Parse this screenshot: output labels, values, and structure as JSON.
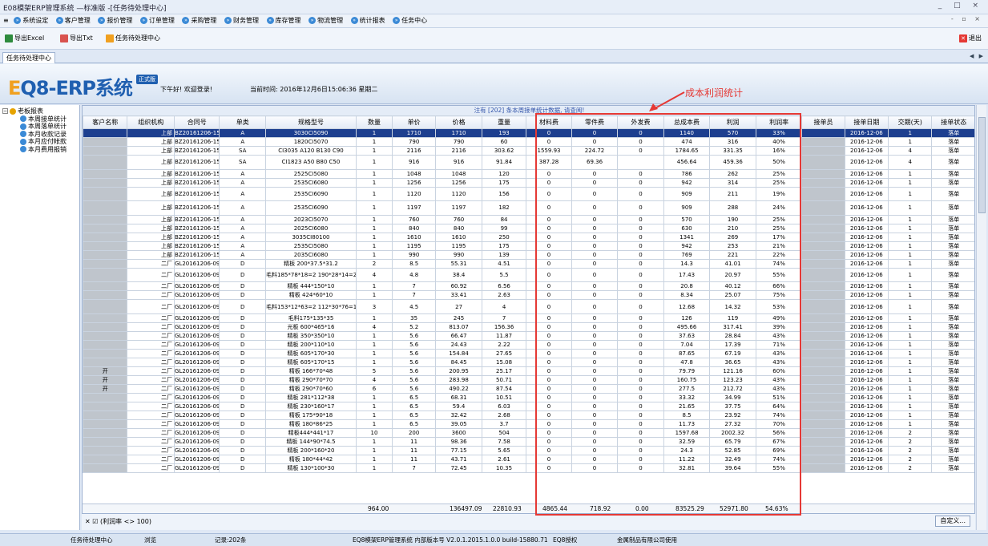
{
  "title_bar": {
    "title": "E08模架ERP管理系统 —标准版 -[任务待处理中心]",
    "window_ctrls": "_ □ ×"
  },
  "menu": {
    "items": [
      "系统设定",
      "客户管理",
      "报价管理",
      "订单管理",
      "采购管理",
      "财务管理",
      "库存管理",
      "物流管理",
      "统计报表",
      "任务中心"
    ],
    "right_ctrls": "- ▫ ×"
  },
  "toolbar": {
    "export_excel": "导出Excel",
    "export_txt": "导出Txt",
    "task_center": "任务待处理中心",
    "exit": "退出"
  },
  "tab": {
    "label": "任务待处理中心",
    "nav": "◀ ▶"
  },
  "banner": {
    "logo_e": "E",
    "logo_rest": "Q8-ERP系统",
    "badge": "正式版",
    "greeting": "下午好! 欢迎登录!",
    "time": "当前时间: 2016年12月6日15:06:36 星期二"
  },
  "tree": {
    "root": "老板报表",
    "items": [
      "本周接单统计",
      "本周落单统计",
      "本月收款记录",
      "本月应付帐款",
      "本月费用报销"
    ]
  },
  "grid_info": "注有 [202] 条本周接单统计数据, 请查阅!",
  "columns": [
    "客户名称",
    "组织机构",
    "合同号",
    "单类",
    "规格型号",
    "数量",
    "单价",
    "价格",
    "重量",
    "材料费",
    "零件费",
    "外发费",
    "总成本费",
    "利润",
    "利润率",
    "接单员",
    "接单日期",
    "交期(天)",
    "接单状态"
  ],
  "rows": [
    [
      "",
      "上部",
      "BZ20161206-1522",
      "A",
      "3030CI5090",
      "1",
      "1710",
      "1710",
      "193",
      "0",
      "0",
      "0",
      "1140",
      "570",
      "33%",
      "",
      "2016-12-06",
      "1",
      "落单"
    ],
    [
      "",
      "上部",
      "BZ20161206-1522",
      "A",
      "1820CI5070",
      "1",
      "790",
      "790",
      "60",
      "0",
      "0",
      "0",
      "474",
      "316",
      "40%",
      "",
      "2016-12-06",
      "1",
      "落单"
    ],
    [
      "",
      "上部",
      "BZ20161206-1523",
      "SA",
      "CI3035 A120 B130 C90",
      "1",
      "2116",
      "2116",
      "303.62",
      "1559.93",
      "224.72",
      "0",
      "1784.65",
      "331.35",
      "16%",
      "",
      "2016-12-06",
      "4",
      "落单"
    ],
    [
      "",
      "上部",
      "BZ20161206-1527",
      "SA",
      "CI1823 A50 B80 C50",
      "1",
      "916",
      "916",
      "91.84",
      "387.28",
      "69.36",
      "",
      "456.64",
      "459.36",
      "50%",
      "",
      "2016-12-06",
      "4",
      "落单"
    ],
    [
      "",
      "上部",
      "BZ20161206-1528",
      "A",
      "2525CI5080",
      "1",
      "1048",
      "1048",
      "120",
      "0",
      "0",
      "0",
      "786",
      "262",
      "25%",
      "",
      "2016-12-06",
      "1",
      "落单"
    ],
    [
      "",
      "上部",
      "BZ20161206-1528",
      "A",
      "2535CI6080",
      "1",
      "1256",
      "1256",
      "175",
      "0",
      "0",
      "0",
      "942",
      "314",
      "25%",
      "",
      "2016-12-06",
      "1",
      "落单"
    ],
    [
      "",
      "上部",
      "BZ20161206-1532 修1",
      "A",
      "2535CI6090",
      "1",
      "1120",
      "1120",
      "156",
      "0",
      "0",
      "0",
      "909",
      "211",
      "19%",
      "",
      "2016-12-06",
      "1",
      "落单"
    ],
    [
      "",
      "上部",
      "BZ20161206-1532 修1",
      "A",
      "2535CI6090",
      "1",
      "1197",
      "1197",
      "182",
      "0",
      "0",
      "0",
      "909",
      "288",
      "24%",
      "",
      "2016-12-06",
      "1",
      "落单"
    ],
    [
      "",
      "上部",
      "BZ20161206-1533",
      "A",
      "2023CI5070",
      "1",
      "760",
      "760",
      "84",
      "0",
      "0",
      "0",
      "570",
      "190",
      "25%",
      "",
      "2016-12-06",
      "1",
      "落单"
    ],
    [
      "",
      "上部",
      "BZ20161206-1533",
      "A",
      "2025CI6080",
      "1",
      "840",
      "840",
      "99",
      "0",
      "0",
      "0",
      "630",
      "210",
      "25%",
      "",
      "2016-12-06",
      "1",
      "落单"
    ],
    [
      "",
      "上部",
      "BZ20161206-1535",
      "A",
      "3035CI80100",
      "1",
      "1610",
      "1610",
      "250",
      "0",
      "0",
      "0",
      "1341",
      "269",
      "17%",
      "",
      "2016-12-06",
      "1",
      "落单"
    ],
    [
      "",
      "上部",
      "BZ20161206-1536",
      "A",
      "2535CI5080",
      "1",
      "1195",
      "1195",
      "175",
      "0",
      "0",
      "0",
      "942",
      "253",
      "21%",
      "",
      "2016-12-06",
      "1",
      "落单"
    ],
    [
      "",
      "上部",
      "BZ20161206-1537",
      "A",
      "2035CI6080",
      "1",
      "990",
      "990",
      "139",
      "0",
      "0",
      "0",
      "769",
      "221",
      "22%",
      "",
      "2016-12-06",
      "1",
      "落单"
    ],
    [
      "",
      "二厂",
      "GL20161206-0975",
      "D",
      "精板 200*37.5*31.2",
      "2",
      "8.5",
      "55.31",
      "4.51",
      "0",
      "0",
      "0",
      "14.3",
      "41.01",
      "74%",
      "",
      "2016-12-06",
      "1",
      "落单"
    ],
    [
      "",
      "二厂",
      "GL20161206-0975",
      "D",
      "毛料185*78*18=2 190*28*14=2",
      "4",
      "4.8",
      "38.4",
      "5.5",
      "0",
      "0",
      "0",
      "17.43",
      "20.97",
      "55%",
      "",
      "2016-12-06",
      "1",
      "落单"
    ],
    [
      "",
      "二厂",
      "GL20161206-0976",
      "D",
      "精板 444*150*10",
      "1",
      "7",
      "60.92",
      "6.56",
      "0",
      "0",
      "0",
      "20.8",
      "40.12",
      "66%",
      "",
      "2016-12-06",
      "1",
      "落单"
    ],
    [
      "",
      "二厂",
      "GL20161206-0976",
      "D",
      "精板 424*60*10",
      "1",
      "7",
      "33.41",
      "2.63",
      "0",
      "0",
      "0",
      "8.34",
      "25.07",
      "75%",
      "",
      "2016-12-06",
      "1",
      "落单"
    ],
    [
      "",
      "二厂",
      "GL20161206-0976",
      "D",
      "毛料153*12*63=2 112*30*76=1",
      "3",
      "4.5",
      "27",
      "4",
      "0",
      "0",
      "0",
      "12.68",
      "14.32",
      "53%",
      "",
      "2016-12-06",
      "1",
      "落单"
    ],
    [
      "",
      "二厂",
      "GL20161206-0978",
      "D",
      "毛料175*135*35",
      "1",
      "35",
      "245",
      "7",
      "0",
      "0",
      "0",
      "126",
      "119",
      "49%",
      "",
      "2016-12-06",
      "1",
      "落单"
    ],
    [
      "",
      "二厂",
      "GL20161206-0979",
      "D",
      "光板 600*465*16",
      "4",
      "5.2",
      "813.07",
      "156.36",
      "0",
      "0",
      "0",
      "495.66",
      "317.41",
      "39%",
      "",
      "2016-12-06",
      "1",
      "落单"
    ],
    [
      "",
      "二厂",
      "GL20161206-0979",
      "D",
      "精板 350*350*10",
      "1",
      "5.6",
      "66.47",
      "11.87",
      "0",
      "0",
      "0",
      "37.63",
      "28.84",
      "43%",
      "",
      "2016-12-06",
      "1",
      "落单"
    ],
    [
      "",
      "二厂",
      "GL20161206-0979",
      "D",
      "精板 200*110*10",
      "1",
      "5.6",
      "24.43",
      "2.22",
      "0",
      "0",
      "0",
      "7.04",
      "17.39",
      "71%",
      "",
      "2016-12-06",
      "1",
      "落单"
    ],
    [
      "",
      "二厂",
      "GL20161206-0979",
      "D",
      "精板 605*170*30",
      "1",
      "5.6",
      "154.84",
      "27.65",
      "0",
      "0",
      "0",
      "87.65",
      "67.19",
      "43%",
      "",
      "2016-12-06",
      "1",
      "落单"
    ],
    [
      "",
      "二厂",
      "GL20161206-0979",
      "D",
      "精板 605*170*15",
      "1",
      "5.6",
      "84.45",
      "15.08",
      "0",
      "0",
      "0",
      "47.8",
      "36.65",
      "43%",
      "",
      "2016-12-06",
      "1",
      "落单"
    ],
    [
      "开",
      "二厂",
      "GL20161206-0979",
      "D",
      "精板 166*70*48",
      "5",
      "5.6",
      "200.95",
      "25.17",
      "0",
      "0",
      "0",
      "79.79",
      "121.16",
      "60%",
      "",
      "2016-12-06",
      "1",
      "落单"
    ],
    [
      "开",
      "二厂",
      "GL20161206-0979",
      "D",
      "精板 290*70*70",
      "4",
      "5.6",
      "283.98",
      "50.71",
      "0",
      "0",
      "0",
      "160.75",
      "123.23",
      "43%",
      "",
      "2016-12-06",
      "1",
      "落单"
    ],
    [
      "开",
      "二厂",
      "GL20161206-0979",
      "D",
      "精板 290*70*60",
      "6",
      "5.6",
      "490.22",
      "87.54",
      "0",
      "0",
      "0",
      "277.5",
      "212.72",
      "43%",
      "",
      "2016-12-06",
      "1",
      "落单"
    ],
    [
      "",
      "二厂",
      "GL20161206-0980",
      "D",
      "精板 281*112*38",
      "1",
      "6.5",
      "68.31",
      "10.51",
      "0",
      "0",
      "0",
      "33.32",
      "34.99",
      "51%",
      "",
      "2016-12-06",
      "1",
      "落单"
    ],
    [
      "",
      "二厂",
      "GL20161206-0980",
      "D",
      "精板 230*160*17",
      "1",
      "6.5",
      "59.4",
      "6.03",
      "0",
      "0",
      "0",
      "21.65",
      "37.75",
      "64%",
      "",
      "2016-12-06",
      "1",
      "落单"
    ],
    [
      "",
      "二厂",
      "GL20161206-0980",
      "D",
      "精板 175*90*18",
      "1",
      "6.5",
      "32.42",
      "2.68",
      "0",
      "0",
      "0",
      "8.5",
      "23.92",
      "74%",
      "",
      "2016-12-06",
      "1",
      "落单"
    ],
    [
      "",
      "二厂",
      "GL20161206-0980",
      "D",
      "精板 180*86*25",
      "1",
      "6.5",
      "39.05",
      "3.7",
      "0",
      "0",
      "0",
      "11.73",
      "27.32",
      "70%",
      "",
      "2016-12-06",
      "1",
      "落单"
    ],
    [
      "",
      "二厂",
      "GL20161206-0981",
      "D",
      "精板444*441*17",
      "10",
      "200",
      "3600",
      "504",
      "0",
      "0",
      "0",
      "1597.68",
      "2002.32",
      "56%",
      "",
      "2016-12-06",
      "2",
      "落单"
    ],
    [
      "",
      "二厂",
      "GL20161206-0982",
      "D",
      "精板 144*90*74.5",
      "1",
      "11",
      "98.36",
      "7.58",
      "0",
      "0",
      "0",
      "32.59",
      "65.79",
      "67%",
      "",
      "2016-12-06",
      "2",
      "落单"
    ],
    [
      "",
      "二厂",
      "GL20161206-0982",
      "D",
      "精板 200*160*20",
      "1",
      "11",
      "77.15",
      "5.65",
      "0",
      "0",
      "0",
      "24.3",
      "52.85",
      "69%",
      "",
      "2016-12-06",
      "2",
      "落单"
    ],
    [
      "",
      "二厂",
      "GL20161206-0982",
      "D",
      "精板 180*44*42",
      "1",
      "11",
      "43.71",
      "2.61",
      "0",
      "0",
      "0",
      "11.22",
      "32.49",
      "74%",
      "",
      "2016-12-06",
      "2",
      "落单"
    ],
    [
      "",
      "二厂",
      "GL20161206-0982",
      "D",
      "精板 130*100*30",
      "1",
      "7",
      "72.45",
      "10.35",
      "0",
      "0",
      "0",
      "32.81",
      "39.64",
      "55%",
      "",
      "2016-12-06",
      "2",
      "落单"
    ]
  ],
  "totals": {
    "qty": "964.00",
    "price": "136497.09",
    "weight": "22810.93",
    "material": "4865.44",
    "parts": "718.92",
    "outsource": "0.00",
    "total_cost": "83525.29",
    "profit": "52971.80",
    "margin": "54.63%"
  },
  "filter": {
    "text": "(利润率 <> 100)",
    "custom_btn": "自定义..."
  },
  "status": {
    "s1": "任务待处理中心",
    "s2": "浏览",
    "s3": "记录:202条",
    "s4": "EQ8模架ERP管理系统 内部版本号 V2.0.1.2015.1.0.0 build-15880.71",
    "s5": "EQ8授权",
    "s6": "金属制品有限公司使用"
  },
  "annotation": {
    "label": "成本利润统计",
    "color": "#e53935"
  }
}
